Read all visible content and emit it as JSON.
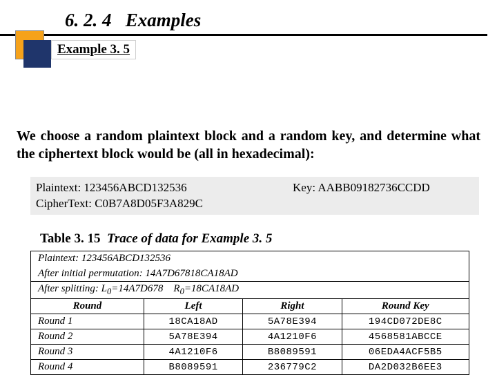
{
  "section": {
    "number": "6. 2. 4",
    "title": "Examples"
  },
  "example": {
    "label": "Example 3. 5"
  },
  "body": "We choose a random plaintext block and a random key, and determine what the ciphertext block would be (all in hexadecimal):",
  "info": {
    "plaintext_label": "Plaintext:",
    "plaintext_value": "123456ABCD132536",
    "key_label": "Key:",
    "key_value": "AABB09182736CCDD",
    "cipher_label": "CipherText:",
    "cipher_value": "C0B7A8D05F3A829C"
  },
  "table": {
    "caption_head": "Table  3. 15",
    "caption_title": "Trace of data for Example 3. 5",
    "header_line1": "Plaintext: 123456ABCD132536",
    "header_line2_a": "After initial permutation: 14A7D67818CA18AD",
    "header_line2_b_prefix": "After splitting: L",
    "header_line2_b_l": "=14A7D678",
    "header_line2_b_gap": "   R",
    "header_line2_b_r": "=18CA18AD",
    "cols": {
      "round": "Round",
      "left": "Left",
      "right": "Right",
      "key": "Round Key"
    },
    "rows": [
      {
        "label": "Round 1",
        "left": "18CA18AD",
        "right": "5A78E394",
        "key": "194CD072DE8C"
      },
      {
        "label": "Round 2",
        "left": "5A78E394",
        "right": "4A1210F6",
        "key": "4568581ABCCE"
      },
      {
        "label": "Round 3",
        "left": "4A1210F6",
        "right": "B8089591",
        "key": "06EDA4ACF5B5"
      },
      {
        "label": "Round 4",
        "left": "B8089591",
        "right": "236779C2",
        "key": "DA2D032B6EE3"
      }
    ]
  }
}
